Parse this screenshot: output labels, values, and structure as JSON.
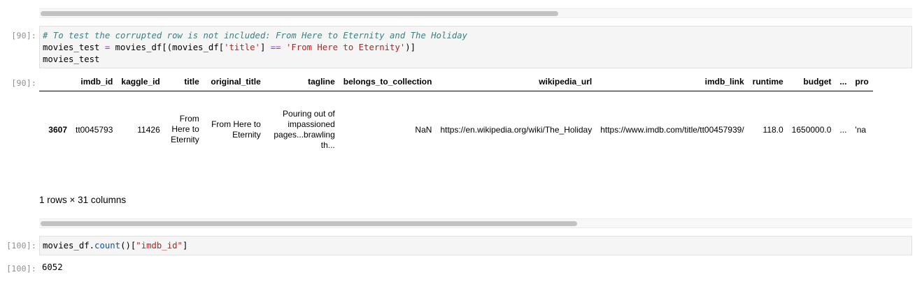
{
  "top_scrollbar": {
    "thumb_fraction": 0.59
  },
  "cell_90": {
    "in_prompt": "[90]:",
    "out_prompt": "[90]:",
    "code": {
      "line1": "# To test the corrupted row is not included: From Here to Eternity and The Holiday",
      "line2_a": "movies_test",
      "line2_b": " ",
      "line2_c": "=",
      "line2_d": " movies_df[(movies_df[",
      "line2_e": "'title'",
      "line2_f": "] ",
      "line2_g": "==",
      "line2_h": " ",
      "line2_i": "'From Here to Eternity'",
      "line2_j": ")]",
      "line3": "movies_test"
    },
    "table": {
      "columns": [
        "",
        "imdb_id",
        "kaggle_id",
        "title",
        "original_title",
        "tagline",
        "belongs_to_collection",
        "wikipedia_url",
        "imdb_link",
        "runtime",
        "budget",
        "...",
        "pro"
      ],
      "row": {
        "index": "3607",
        "imdb_id": "tt0045793",
        "kaggle_id": "11426",
        "title": "From Here to Eternity",
        "original_title": "From Here to Eternity",
        "tagline": "Pouring out of impassioned pages...brawling th...",
        "belongs_to_collection": "NaN",
        "wikipedia_url": "https://en.wikipedia.org/wiki/The_Holiday",
        "imdb_link": "https://www.imdb.com/title/tt00457939/",
        "runtime": "118.0",
        "budget": "1650000.0",
        "ellipsis": "...",
        "pro": "'na"
      }
    },
    "row_count_text": "1 rows × 31 columns",
    "bottom_scrollbar": {
      "thumb_fraction": 0.61
    }
  },
  "cell_100": {
    "in_prompt": "[100]:",
    "out_prompt": "[100]:",
    "code": {
      "a": "movies_df",
      "b": ".",
      "c": "count",
      "d": "()[",
      "e": "\"imdb_id\"",
      "f": "]"
    },
    "output": "6052"
  },
  "colors": {
    "comment": "#408080",
    "string": "#ba2121",
    "operator": "#aa22ff",
    "prompt": "#8f8f8f",
    "cell_bg": "#f5f5f5"
  }
}
